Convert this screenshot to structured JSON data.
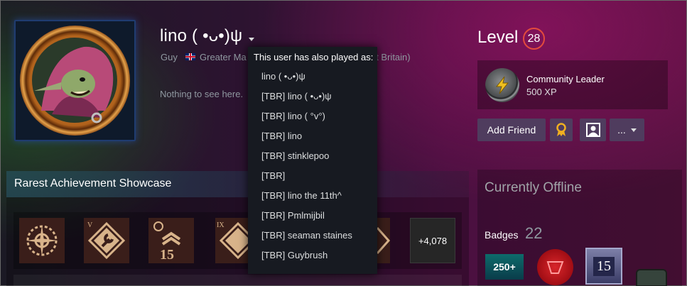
{
  "profile": {
    "persona_name": "lino ( •ᴗ•)ψ",
    "real_name": "Guy",
    "location": "Greater Manchester, England, United Kingdom (Great Britain)",
    "location_visible": "Greater Ma",
    "location_tail": "eat Britain)",
    "summary": "Nothing to see here."
  },
  "alias_dropdown": {
    "title": "This user has also played as:",
    "items": [
      "lino ( •ᴗ•)ψ",
      "[TBR] lino ( •ᴗ•)ψ",
      "[TBR] lino ( °v°)",
      "[TBR] lino",
      "[TBR] stinklepoo",
      "[TBR]",
      "[TBR] lino the 11th^",
      "[TBR] Pmlmijbil",
      "[TBR] seaman staines",
      "[TBR] Guybrush"
    ]
  },
  "level": {
    "label": "Level",
    "value": "28"
  },
  "favorite_badge": {
    "name": "Community Leader",
    "xp": "500 XP",
    "icon": "lightning-bolt-icon"
  },
  "actions": {
    "add_friend": "Add Friend",
    "award_icon": "award-ribbon-icon",
    "profile_icon": "user-portrait-icon",
    "more": "..."
  },
  "showcase": {
    "title": "Rarest Achievement Showcase",
    "more_count": "+4,078",
    "achievements": [
      {
        "icon": "compass-wreath-icon",
        "numeral": ""
      },
      {
        "icon": "wrench-diamond-icon",
        "numeral": "V"
      },
      {
        "icon": "rank-15-chevron-icon",
        "numeral": "15"
      },
      {
        "icon": "wrench-diamond-icon",
        "numeral": "IX"
      }
    ]
  },
  "status": {
    "text": "Currently Offline"
  },
  "badges": {
    "label": "Badges",
    "count": "22",
    "items": [
      {
        "icon": "years-badge-icon",
        "text": "250+"
      },
      {
        "icon": "wax-seal-icon",
        "text": ""
      },
      {
        "icon": "level-15-badge-icon",
        "text": "15"
      },
      {
        "icon": "robot-badge-icon",
        "text": ""
      }
    ]
  },
  "colors": {
    "level_ring": "#e34b3d",
    "button_bg": "#4f3c5e",
    "popup_bg": "#171a21"
  }
}
